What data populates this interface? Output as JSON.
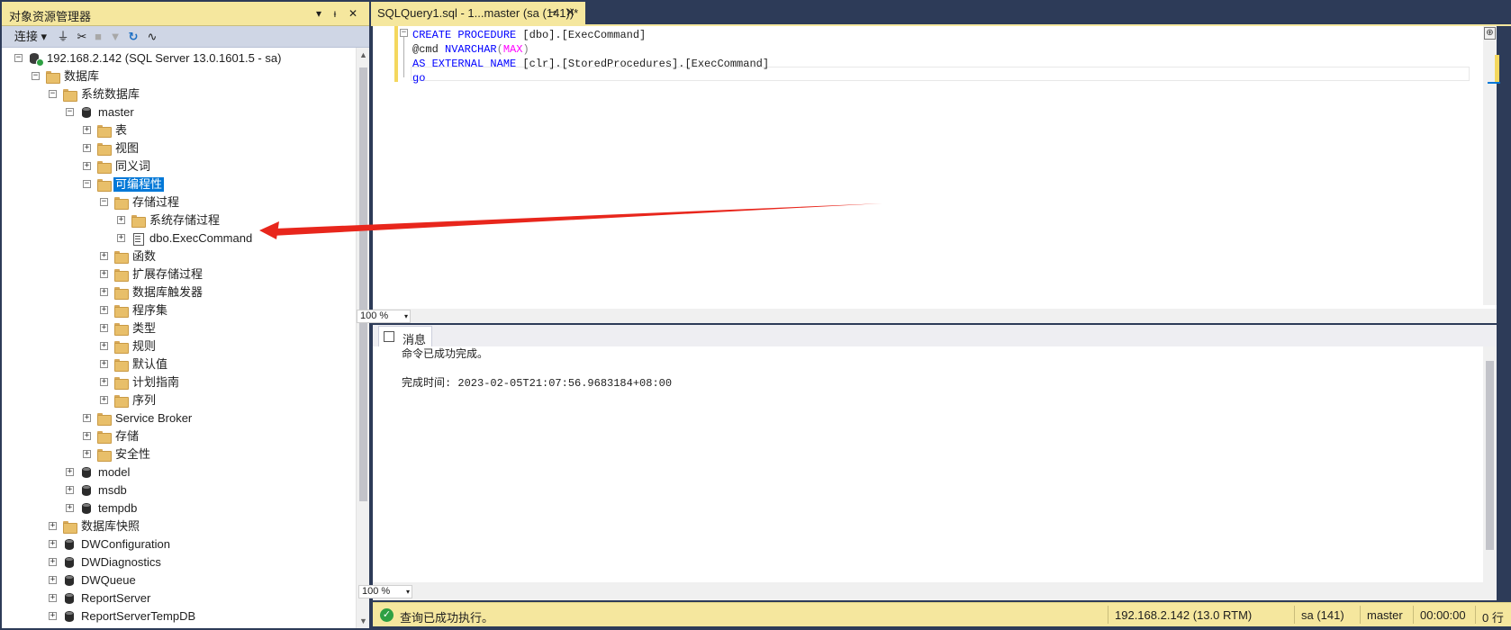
{
  "object_explorer": {
    "title": "对象资源管理器",
    "toolbar": {
      "connect_label": "连接"
    },
    "tree": [
      {
        "label": "192.168.2.142 (SQL Server 13.0.1601.5 - sa)",
        "icon": "server-icon",
        "expander": "⊟"
      },
      {
        "label": "数据库",
        "icon": "folder-icon",
        "expander": "⊟"
      },
      {
        "label": "系统数据库",
        "icon": "folder-icon",
        "expander": "⊟"
      },
      {
        "label": "master",
        "icon": "database-icon",
        "expander": "⊟"
      },
      {
        "label": "表",
        "icon": "folder-icon",
        "expander": "⊞"
      },
      {
        "label": "视图",
        "icon": "folder-icon",
        "expander": "⊞"
      },
      {
        "label": "同义词",
        "icon": "folder-icon",
        "expander": "⊞"
      },
      {
        "label": "可编程性",
        "icon": "folder-icon",
        "expander": "⊟",
        "selected": true
      },
      {
        "label": "存储过程",
        "icon": "folder-icon",
        "expander": "⊟"
      },
      {
        "label": "系统存储过程",
        "icon": "folder-icon",
        "expander": "⊞"
      },
      {
        "label": "dbo.ExecCommand",
        "icon": "stored-procedure-icon",
        "expander": "⊞"
      },
      {
        "label": "函数",
        "icon": "folder-icon",
        "expander": "⊞"
      },
      {
        "label": "扩展存储过程",
        "icon": "folder-icon",
        "expander": "⊞"
      },
      {
        "label": "数据库触发器",
        "icon": "folder-icon",
        "expander": "⊞"
      },
      {
        "label": "程序集",
        "icon": "folder-icon",
        "expander": "⊞"
      },
      {
        "label": "类型",
        "icon": "folder-icon",
        "expander": "⊞"
      },
      {
        "label": "规则",
        "icon": "folder-icon",
        "expander": "⊞"
      },
      {
        "label": "默认值",
        "icon": "folder-icon",
        "expander": "⊞"
      },
      {
        "label": "计划指南",
        "icon": "folder-icon",
        "expander": "⊞"
      },
      {
        "label": "序列",
        "icon": "folder-icon",
        "expander": "⊞"
      },
      {
        "label": "Service Broker",
        "icon": "folder-icon",
        "expander": "⊞"
      },
      {
        "label": "存储",
        "icon": "folder-icon",
        "expander": "⊞"
      },
      {
        "label": "安全性",
        "icon": "folder-icon",
        "expander": "⊞"
      },
      {
        "label": "model",
        "icon": "database-icon",
        "expander": "⊞"
      },
      {
        "label": "msdb",
        "icon": "database-icon",
        "expander": "⊞"
      },
      {
        "label": "tempdb",
        "icon": "database-icon",
        "expander": "⊞"
      },
      {
        "label": "数据库快照",
        "icon": "folder-icon",
        "expander": "⊞"
      },
      {
        "label": "DWConfiguration",
        "icon": "database-icon",
        "expander": "⊞"
      },
      {
        "label": "DWDiagnostics",
        "icon": "database-icon",
        "expander": "⊞"
      },
      {
        "label": "DWQueue",
        "icon": "database-icon",
        "expander": "⊞"
      },
      {
        "label": "ReportServer",
        "icon": "database-icon",
        "expander": "⊞"
      },
      {
        "label": "ReportServerTempDB",
        "icon": "database-icon",
        "expander": "⊞"
      }
    ]
  },
  "document_tab": {
    "title": "SQLQuery1.sql - 1...master (sa (141))*"
  },
  "editor": {
    "lines": [
      [
        "kw:CREATE PROCEDURE ",
        "tx:[dbo].[ExecCommand]"
      ],
      [
        "tx:@cmd ",
        "kw:NVARCHAR",
        "gy:(",
        "fn:MAX",
        "gy:)"
      ],
      [
        "kw:AS EXTERNAL NAME ",
        "tx:[clr].[StoredProcedures].[ExecCommand]"
      ],
      [
        "kw:go"
      ]
    ],
    "zoom": "100 %"
  },
  "results": {
    "tab_label": "消息",
    "messages": [
      "命令已成功完成。",
      "",
      "完成时间: 2023-02-05T21:07:56.9683184+08:00"
    ],
    "zoom": "100 %"
  },
  "status_bar": {
    "status_text": "查询已成功执行。",
    "server": "192.168.2.142 (13.0 RTM)",
    "user": "sa (141)",
    "database": "master",
    "elapsed": "00:00:00",
    "rows": "0 行"
  },
  "colors": {
    "accent_tab": "#f5e79e",
    "selection": "#0078d7",
    "keyword": "#0000ff",
    "function": "#ff00ff",
    "annotation_arrow": "#e8261c"
  }
}
